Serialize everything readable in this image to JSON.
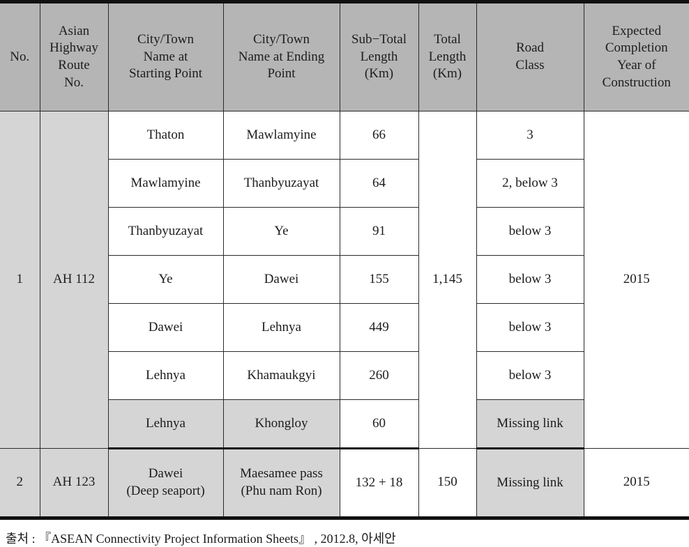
{
  "table": {
    "headers": [
      "No.",
      "Asian Highway Route No.",
      "City/Town Name at Starting Point",
      "City/Town Name at Ending Point",
      "Sub−Total Length (Km)",
      "Total Length (Km)",
      "Road Class",
      "Expected Completion Year of Construction"
    ],
    "header_lines": {
      "no": [
        "No."
      ],
      "route": [
        "Asian",
        "Highway",
        "Route",
        "No."
      ],
      "start": [
        "City/Town",
        "Name  at",
        "Starting  Point"
      ],
      "end": [
        "City/Town",
        "Name  at Ending",
        "Point"
      ],
      "subtotal": [
        "Sub−Total",
        "Length",
        "(Km)"
      ],
      "total": [
        "Total",
        "Length",
        "(Km)"
      ],
      "roadclass": [
        "Road",
        "Class"
      ],
      "year": [
        "Expected",
        "Completion",
        "Year  of",
        "Construction"
      ]
    },
    "groups": [
      {
        "no": "1",
        "route": "AH 112",
        "total_length": "1,145",
        "year": "2015",
        "rows": [
          {
            "start": "Thaton",
            "end": "Mawlamyine",
            "subtotal": "66",
            "road_class": "3",
            "road_class_shaded": false,
            "row_shaded": false
          },
          {
            "start": "Mawlamyine",
            "end": "Thanbyuzayat",
            "subtotal": "64",
            "road_class": "2, below 3",
            "road_class_shaded": false,
            "row_shaded": false
          },
          {
            "start": "Thanbyuzayat",
            "end": "Ye",
            "subtotal": "91",
            "road_class": "below 3",
            "road_class_shaded": false,
            "row_shaded": false
          },
          {
            "start": "Ye",
            "end": "Dawei",
            "subtotal": "155",
            "road_class": "below 3",
            "road_class_shaded": false,
            "row_shaded": false
          },
          {
            "start": "Dawei",
            "end": "Lehnya",
            "subtotal": "449",
            "road_class": "below 3",
            "road_class_shaded": false,
            "row_shaded": false
          },
          {
            "start": "Lehnya",
            "end": "Khamaukgyi",
            "subtotal": "260",
            "road_class": "below 3",
            "road_class_shaded": false,
            "row_shaded": false
          },
          {
            "start": "Lehnya",
            "end": "Khongloy",
            "subtotal": "60",
            "road_class": "Missing link",
            "road_class_shaded": true,
            "row_shaded": true
          }
        ]
      },
      {
        "no": "2",
        "route": "AH 123",
        "total_length": "150",
        "year": "2015",
        "rows": [
          {
            "start_lines": [
              "Dawei",
              "(Deep seaport)"
            ],
            "end_lines": [
              "Maesamee pass",
              "(Phu nam Ron)"
            ],
            "subtotal": "132 + 18",
            "road_class": "Missing link",
            "road_class_shaded": true,
            "row_shaded": true
          }
        ]
      }
    ]
  },
  "caption": "출처 : 『ASEAN Connectivity Project Information Sheets』 , 2012.8, 아세안",
  "colors": {
    "header_gray": "#b5b5b5",
    "body_gray": "#d5d5d5",
    "white": "#ffffff",
    "border": "#2b2b2b",
    "rule": "#111111"
  }
}
